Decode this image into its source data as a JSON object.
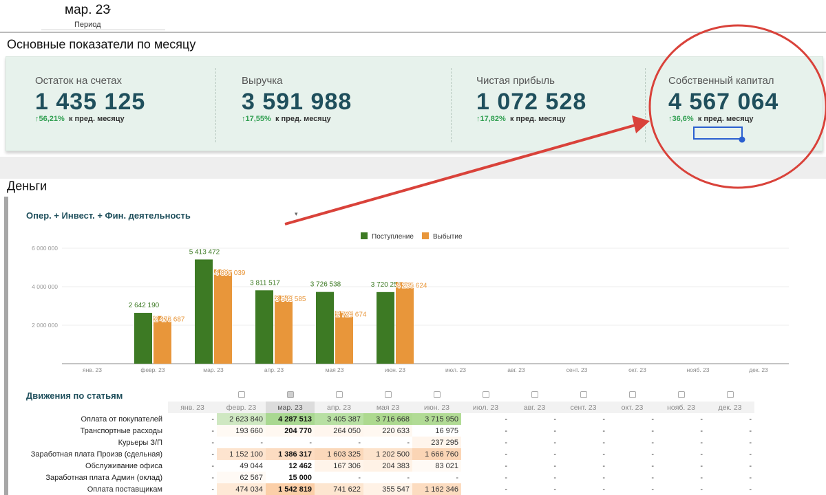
{
  "period": {
    "value": "мар. 23",
    "label": "Период"
  },
  "sections": {
    "kpi_title": "Основные показатели по месяцу",
    "money_title": "Деньги"
  },
  "kpis": [
    {
      "label": "Остаток на счетах",
      "value": "1 435 125",
      "delta": "↑56,21%",
      "suffix": "к пред. месяцу"
    },
    {
      "label": "Выручка",
      "value": "3 591 988",
      "delta": "↑17,55%",
      "suffix": "к пред. месяцу"
    },
    {
      "label": "Чистая прибыль",
      "value": "1 072 528",
      "delta": "↑17,82%",
      "suffix": "к пред. месяцу"
    },
    {
      "label": "Собственный капитал",
      "value": "4 567 064",
      "delta": "↑36,6%",
      "suffix": "к пред. месяцу"
    }
  ],
  "chart": {
    "title": "Опер. + Инвест. + Фин. деятельность"
  },
  "chart_data": {
    "type": "bar",
    "categories": [
      "янв. 23",
      "февр. 23",
      "мар. 23",
      "апр. 23",
      "мая 23",
      "июн. 23",
      "июл. 23",
      "авг. 23",
      "сент. 23",
      "окт. 23",
      "нояб. 23",
      "дек. 23"
    ],
    "series": [
      {
        "name": "Поступление",
        "color": "#3d7a24",
        "values": [
          null,
          2642190,
          5413472,
          3811517,
          3726538,
          3720250,
          null,
          null,
          null,
          null,
          null,
          null
        ],
        "labels": [
          "",
          "2 642 190",
          "5 413 472",
          "3 811 517",
          "3 726 538",
          "3 720 250",
          "",
          "",
          "",
          "",
          "",
          ""
        ]
      },
      {
        "name": "Выбытие",
        "color": "#e8963a",
        "values": [
          null,
          2476687,
          4897039,
          3543585,
          2729674,
          4235624,
          null,
          null,
          null,
          null,
          null,
          null
        ],
        "labels": [
          "",
          "2 476 687",
          "4 897 039",
          "3 543 585",
          "2 729 674",
          "4 235 624",
          "",
          "",
          "",
          "",
          "",
          ""
        ]
      }
    ],
    "yticks": [
      {
        "value": 2000000,
        "label": "2 000 000"
      },
      {
        "value": 4000000,
        "label": "4 000 000"
      },
      {
        "value": 6000000,
        "label": "6 000 000"
      }
    ],
    "ylim": [
      0,
      6000000
    ],
    "legend": "top-center"
  },
  "table": {
    "title": "Движения по статьям",
    "months": [
      "янв. 23",
      "февр. 23",
      "мар. 23",
      "апр. 23",
      "мая 23",
      "июн. 23",
      "июл. 23",
      "авг. 23",
      "сент. 23",
      "окт. 23",
      "нояб. 23",
      "дек. 23"
    ],
    "current_month_index": 2,
    "rows": [
      {
        "label": "Оплата от покупателей",
        "cells": [
          "-",
          "2 623 840",
          "4 287 513",
          "3 405 387",
          "3 716 668",
          "3 715 950",
          "-",
          "-",
          "-",
          "-",
          "-",
          "-"
        ]
      },
      {
        "label": "Транспортные расходы",
        "cells": [
          "-",
          "193 660",
          "204 770",
          "264 050",
          "220 633",
          "16 975",
          "-",
          "-",
          "-",
          "-",
          "-",
          "-"
        ]
      },
      {
        "label": "Курьеры З/П",
        "cells": [
          "-",
          "-",
          "-",
          "-",
          "-",
          "237 295",
          "-",
          "-",
          "-",
          "-",
          "-",
          "-"
        ]
      },
      {
        "label": "Заработная плата Произв (сдельная)",
        "cells": [
          "-",
          "1 152 100",
          "1 386 317",
          "1 603 325",
          "1 202 500",
          "1 666 760",
          "-",
          "-",
          "-",
          "-",
          "-",
          "-"
        ]
      },
      {
        "label": "Обслуживание офиса",
        "cells": [
          "-",
          "49 044",
          "12 462",
          "167 306",
          "204 383",
          "83 021",
          "-",
          "-",
          "-",
          "-",
          "-",
          "-"
        ]
      },
      {
        "label": "Заработная плата Админ (оклад)",
        "cells": [
          "-",
          "62 567",
          "15 000",
          "-",
          "-",
          "-",
          "-",
          "-",
          "-",
          "-",
          "-",
          "-"
        ]
      },
      {
        "label": "Оплата поставщикам",
        "cells": [
          "-",
          "474 034",
          "1 542 819",
          "741 622",
          "355 547",
          "1 162 346",
          "-",
          "-",
          "-",
          "-",
          "-",
          "-"
        ]
      }
    ],
    "row_colors": [
      [
        "",
        "#cfe8c2",
        "#a9d891",
        "#b8e0a3",
        "#add98f",
        "#b1db95",
        "",
        "",
        "",
        "",
        "",
        ""
      ],
      [
        "",
        "#fffaf4",
        "#fff8f1",
        "#fff6ee",
        "#fff8f1",
        "",
        "",
        "",
        "",
        "",
        "",
        ""
      ],
      [
        "",
        "",
        "",
        "",
        "",
        "#fff5ec",
        "",
        "",
        "",
        "",
        "",
        ""
      ],
      [
        "",
        "#fde4cf",
        "#fcdcc1",
        "#fbd8ba",
        "#fde3cc",
        "#fbd5b5",
        "",
        "",
        "",
        "",
        "",
        ""
      ],
      [
        "",
        "",
        "",
        "#fff4ea",
        "#fff2e6",
        "#fffaf5",
        "",
        "",
        "",
        "",
        "",
        ""
      ],
      [
        "",
        "#fffaf5",
        "",
        "",
        "",
        "",
        "",
        "",
        "",
        "",
        "",
        ""
      ],
      [
        "",
        "#fee9d6",
        "#fbcfa8",
        "#fde6d0",
        "#fff2e6",
        "#fcdcc0",
        "",
        "",
        "",
        "",
        "",
        ""
      ]
    ]
  }
}
